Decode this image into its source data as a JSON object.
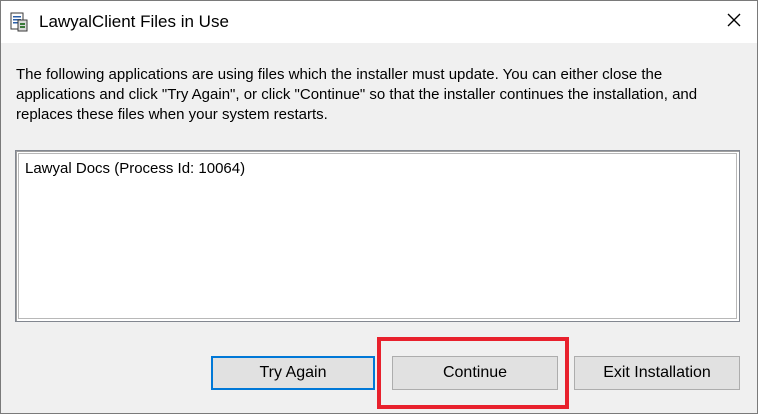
{
  "window": {
    "title": "LawyalClient Files in Use",
    "app_icon": "installer-icon",
    "close_icon": "close-icon"
  },
  "message": "The following applications are using files which the installer must update. You can either close the applications and click \"Try Again\", or click \"Continue\" so that the installer continues the installation, and replaces these files when your system restarts.",
  "process_list": {
    "items": [
      "Lawyal Docs (Process Id: 10064)"
    ]
  },
  "buttons": {
    "try_again": "Try Again",
    "continue": "Continue",
    "exit_installation": "Exit Installation"
  },
  "colors": {
    "highlight": "#e8202c",
    "focus_border": "#0078d7"
  }
}
